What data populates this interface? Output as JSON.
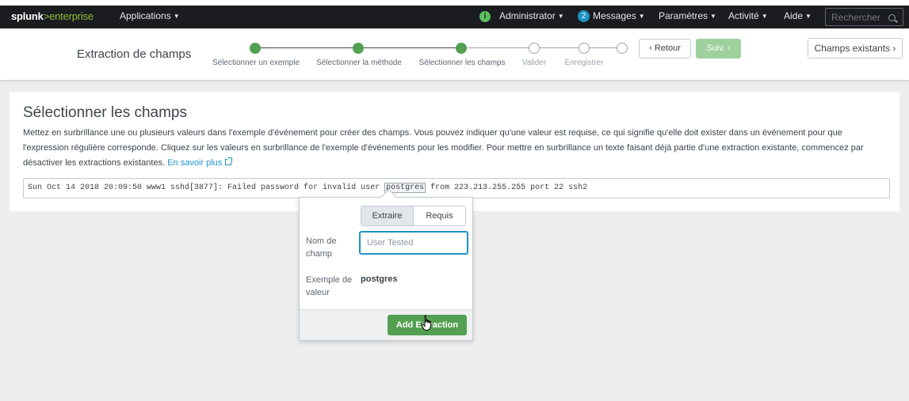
{
  "navbar": {
    "logo_brand": "splunk",
    "logo_gt": ">",
    "logo_product": "enterprise",
    "applications": "Applications",
    "status_icon": "check-circle-icon",
    "admin": "Administrator",
    "messages_count": "2",
    "messages": "Messages",
    "settings": "Paramètres",
    "activity": "Activité",
    "help": "Aide",
    "search_placeholder": "Rechercher"
  },
  "wizard": {
    "title": "Extraction de champs",
    "steps": [
      {
        "label": "Sélectionner un exemple",
        "done": true
      },
      {
        "label": "Sélectionner la méthode",
        "done": true
      },
      {
        "label": "Sélectionner les champs",
        "done": true
      },
      {
        "label": "Valider",
        "done": false
      },
      {
        "label": "Enregistrer",
        "done": false
      },
      {
        "label": "",
        "done": false
      }
    ],
    "back_label": "‹ Retour",
    "next_label": "Suiv. ›",
    "existing_fields_label": "Champs existants ›"
  },
  "panel": {
    "title": "Sélectionner les champs",
    "description": "Mettez en surbrillance une ou plusieurs valeurs dans l'exemple d'événement pour créer des champs. Vous pouvez indiquer qu'une valeur est requise, ce qui signifie qu'elle doit exister dans un événement pour que l'expression régulière corresponde. Cliquez sur les valeurs en surbrillance de l'exemple d'événements pour les modifier. Pour mettre en surbrillance un texte faisant déjà partie d'une extraction existante, commencez par désactiver les extractions existantes.",
    "learn_more": "En savoir plus",
    "event_before": "Sun Oct 14 2018 20:09:50 www1 sshd[3877]: Failed password for invalid user ",
    "event_highlight": "postgres",
    "event_after": " from 223.213.255.255 port 22 ssh2"
  },
  "popover": {
    "tab_extract": "Extraire",
    "tab_required": "Requis",
    "field_name_label": "Nom de champ",
    "field_name_value": "User Tested",
    "example_label": "Exemple de valeur",
    "example_value": "postgres",
    "add_button": "Add Extraction"
  }
}
